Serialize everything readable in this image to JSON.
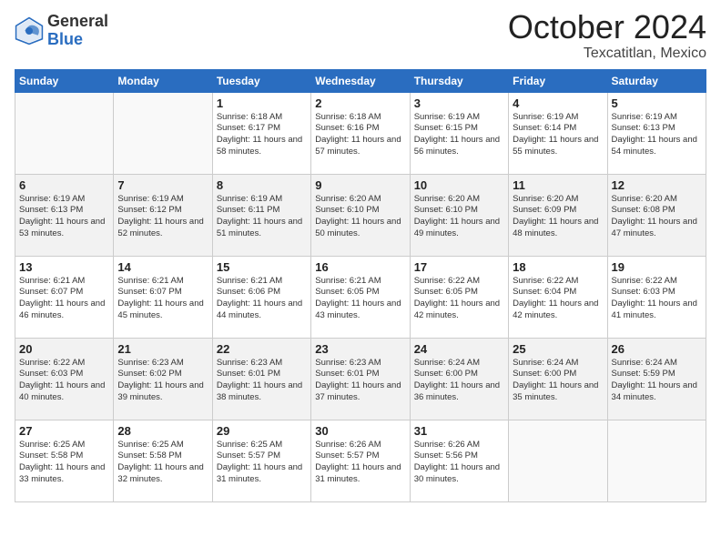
{
  "logo": {
    "general": "General",
    "blue": "Blue"
  },
  "header": {
    "month": "October 2024",
    "location": "Texcatitlan, Mexico"
  },
  "weekdays": [
    "Sunday",
    "Monday",
    "Tuesday",
    "Wednesday",
    "Thursday",
    "Friday",
    "Saturday"
  ],
  "weeks": [
    [
      {
        "day": "",
        "info": ""
      },
      {
        "day": "",
        "info": ""
      },
      {
        "day": "1",
        "info": "Sunrise: 6:18 AM\nSunset: 6:17 PM\nDaylight: 11 hours and 58 minutes."
      },
      {
        "day": "2",
        "info": "Sunrise: 6:18 AM\nSunset: 6:16 PM\nDaylight: 11 hours and 57 minutes."
      },
      {
        "day": "3",
        "info": "Sunrise: 6:19 AM\nSunset: 6:15 PM\nDaylight: 11 hours and 56 minutes."
      },
      {
        "day": "4",
        "info": "Sunrise: 6:19 AM\nSunset: 6:14 PM\nDaylight: 11 hours and 55 minutes."
      },
      {
        "day": "5",
        "info": "Sunrise: 6:19 AM\nSunset: 6:13 PM\nDaylight: 11 hours and 54 minutes."
      }
    ],
    [
      {
        "day": "6",
        "info": "Sunrise: 6:19 AM\nSunset: 6:13 PM\nDaylight: 11 hours and 53 minutes."
      },
      {
        "day": "7",
        "info": "Sunrise: 6:19 AM\nSunset: 6:12 PM\nDaylight: 11 hours and 52 minutes."
      },
      {
        "day": "8",
        "info": "Sunrise: 6:19 AM\nSunset: 6:11 PM\nDaylight: 11 hours and 51 minutes."
      },
      {
        "day": "9",
        "info": "Sunrise: 6:20 AM\nSunset: 6:10 PM\nDaylight: 11 hours and 50 minutes."
      },
      {
        "day": "10",
        "info": "Sunrise: 6:20 AM\nSunset: 6:10 PM\nDaylight: 11 hours and 49 minutes."
      },
      {
        "day": "11",
        "info": "Sunrise: 6:20 AM\nSunset: 6:09 PM\nDaylight: 11 hours and 48 minutes."
      },
      {
        "day": "12",
        "info": "Sunrise: 6:20 AM\nSunset: 6:08 PM\nDaylight: 11 hours and 47 minutes."
      }
    ],
    [
      {
        "day": "13",
        "info": "Sunrise: 6:21 AM\nSunset: 6:07 PM\nDaylight: 11 hours and 46 minutes."
      },
      {
        "day": "14",
        "info": "Sunrise: 6:21 AM\nSunset: 6:07 PM\nDaylight: 11 hours and 45 minutes."
      },
      {
        "day": "15",
        "info": "Sunrise: 6:21 AM\nSunset: 6:06 PM\nDaylight: 11 hours and 44 minutes."
      },
      {
        "day": "16",
        "info": "Sunrise: 6:21 AM\nSunset: 6:05 PM\nDaylight: 11 hours and 43 minutes."
      },
      {
        "day": "17",
        "info": "Sunrise: 6:22 AM\nSunset: 6:05 PM\nDaylight: 11 hours and 42 minutes."
      },
      {
        "day": "18",
        "info": "Sunrise: 6:22 AM\nSunset: 6:04 PM\nDaylight: 11 hours and 42 minutes."
      },
      {
        "day": "19",
        "info": "Sunrise: 6:22 AM\nSunset: 6:03 PM\nDaylight: 11 hours and 41 minutes."
      }
    ],
    [
      {
        "day": "20",
        "info": "Sunrise: 6:22 AM\nSunset: 6:03 PM\nDaylight: 11 hours and 40 minutes."
      },
      {
        "day": "21",
        "info": "Sunrise: 6:23 AM\nSunset: 6:02 PM\nDaylight: 11 hours and 39 minutes."
      },
      {
        "day": "22",
        "info": "Sunrise: 6:23 AM\nSunset: 6:01 PM\nDaylight: 11 hours and 38 minutes."
      },
      {
        "day": "23",
        "info": "Sunrise: 6:23 AM\nSunset: 6:01 PM\nDaylight: 11 hours and 37 minutes."
      },
      {
        "day": "24",
        "info": "Sunrise: 6:24 AM\nSunset: 6:00 PM\nDaylight: 11 hours and 36 minutes."
      },
      {
        "day": "25",
        "info": "Sunrise: 6:24 AM\nSunset: 6:00 PM\nDaylight: 11 hours and 35 minutes."
      },
      {
        "day": "26",
        "info": "Sunrise: 6:24 AM\nSunset: 5:59 PM\nDaylight: 11 hours and 34 minutes."
      }
    ],
    [
      {
        "day": "27",
        "info": "Sunrise: 6:25 AM\nSunset: 5:58 PM\nDaylight: 11 hours and 33 minutes."
      },
      {
        "day": "28",
        "info": "Sunrise: 6:25 AM\nSunset: 5:58 PM\nDaylight: 11 hours and 32 minutes."
      },
      {
        "day": "29",
        "info": "Sunrise: 6:25 AM\nSunset: 5:57 PM\nDaylight: 11 hours and 31 minutes."
      },
      {
        "day": "30",
        "info": "Sunrise: 6:26 AM\nSunset: 5:57 PM\nDaylight: 11 hours and 31 minutes."
      },
      {
        "day": "31",
        "info": "Sunrise: 6:26 AM\nSunset: 5:56 PM\nDaylight: 11 hours and 30 minutes."
      },
      {
        "day": "",
        "info": ""
      },
      {
        "day": "",
        "info": ""
      }
    ]
  ]
}
